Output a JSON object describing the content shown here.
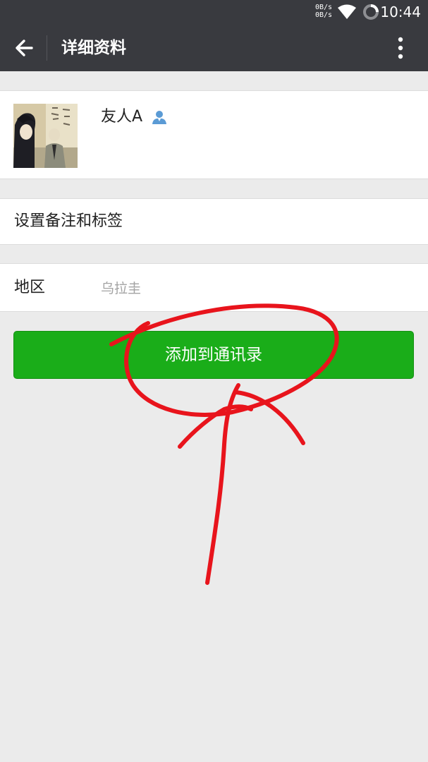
{
  "status_bar": {
    "net_up": "0B/s",
    "net_down": "0B/s",
    "time": "10:44",
    "icons": [
      "wifi-icon",
      "loading-ring-icon"
    ]
  },
  "header": {
    "title": "详细资料",
    "back_icon": "arrow-left-icon",
    "more_icon": "more-vertical-icon"
  },
  "profile": {
    "name": "友人A",
    "badge_icon": "contact-person-icon"
  },
  "remark": {
    "label": "设置备注和标签"
  },
  "region": {
    "label": "地区",
    "value": "乌拉圭"
  },
  "actions": {
    "add_to_contacts": "添加到通讯录"
  },
  "colors": {
    "bar": "#393a3f",
    "background": "#ebebeb",
    "primary_green": "#1aad19",
    "annotation_red": "#e8141c",
    "badge_blue": "#5b9bd5"
  }
}
